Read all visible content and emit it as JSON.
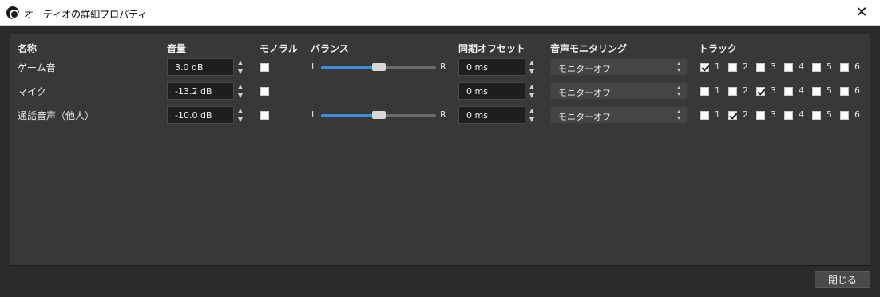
{
  "window": {
    "title": "オーディオの詳細プロパティ",
    "close_glyph": "✕"
  },
  "headers": {
    "name": "名称",
    "volume": "音量",
    "mono": "モノラル",
    "balance": "バランス",
    "sync_offset": "同期オフセット",
    "monitoring": "音声モニタリング",
    "tracks": "トラック"
  },
  "slider": {
    "left_label": "L",
    "right_label": "R"
  },
  "rows": [
    {
      "name": "ゲーム音",
      "volume": "3.0 dB",
      "mono": false,
      "has_balance": true,
      "balance": 0.5,
      "sync_offset": "0 ms",
      "monitoring": "モニターオフ",
      "tracks": [
        true,
        false,
        false,
        false,
        false,
        false
      ]
    },
    {
      "name": "マイク",
      "volume": "-13.2 dB",
      "mono": false,
      "has_balance": false,
      "balance": 0.5,
      "sync_offset": "0 ms",
      "monitoring": "モニターオフ",
      "tracks": [
        false,
        false,
        true,
        false,
        false,
        false
      ]
    },
    {
      "name": "通話音声（他人）",
      "volume": "-10.0 dB",
      "mono": false,
      "has_balance": true,
      "balance": 0.5,
      "sync_offset": "0 ms",
      "monitoring": "モニターオフ",
      "tracks": [
        false,
        true,
        false,
        false,
        false,
        false
      ]
    }
  ],
  "track_labels": [
    "1",
    "2",
    "3",
    "4",
    "5",
    "6"
  ],
  "footer": {
    "close_label": "閉じる"
  },
  "colors": {
    "accent": "#3e8ed8",
    "panel": "#383838",
    "background": "#2b2b2b"
  }
}
